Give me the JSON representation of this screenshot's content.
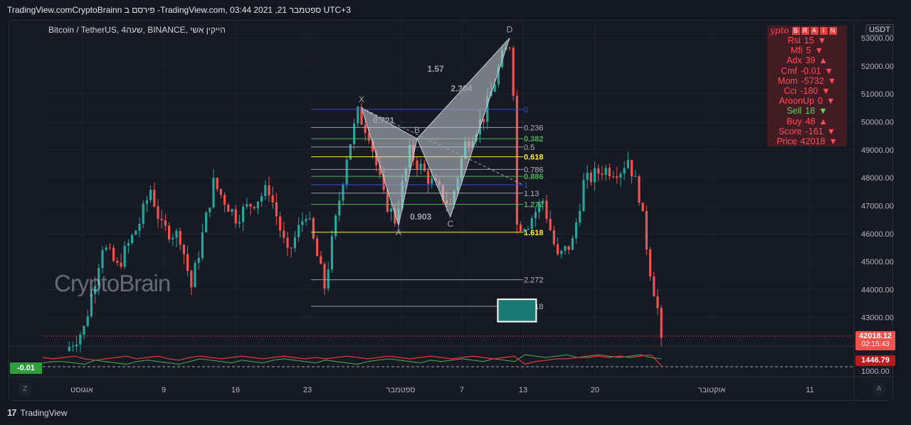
{
  "header": {
    "title": "TradingView.comCryptoBrainn פירסם ב -TradingView.com, 03:44 2021 ,21 ספטמבר UTC+3"
  },
  "symbol": {
    "label": "Bitcoin / TetherUS, 4שעה, BINANCE, הייקין אשי"
  },
  "currency_button": "USDT",
  "watermark": "CryptoBrain",
  "footer": {
    "brand": "TradingView"
  },
  "colors": {
    "up": "#26a69a",
    "down": "#ef5350",
    "grid": "#1f2330",
    "pattern": "#c8ccd4"
  },
  "panel": {
    "brand": "ypto",
    "tags": [
      "B",
      "R",
      "A",
      "I",
      "N"
    ],
    "rows": [
      {
        "name": "Rsi",
        "value": "15",
        "dir": "down"
      },
      {
        "name": "Mfi",
        "value": "5",
        "dir": "down"
      },
      {
        "name": "Adx",
        "value": "39",
        "dir": "up"
      },
      {
        "name": "Cmf",
        "value": "-0.01",
        "dir": "down"
      },
      {
        "name": "Mom",
        "value": "-5732",
        "dir": "down"
      },
      {
        "name": "Cci",
        "value": "-180",
        "dir": "down"
      },
      {
        "name": "AroonUp",
        "value": "0",
        "dir": "down"
      },
      {
        "name": "Sell",
        "value": "18",
        "dir": "down"
      },
      {
        "name": "Buy",
        "value": "48",
        "dir": "up"
      },
      {
        "name": "Score",
        "value": "-161",
        "dir": "down"
      },
      {
        "name": "Price",
        "value": "42018",
        "dir": "down"
      }
    ]
  },
  "price_tags": {
    "current": "42018.12",
    "countdown": "02:15:43",
    "indicator": "1446.79",
    "left_value": "-0.01"
  },
  "chart_data": {
    "type": "candlestick",
    "title": "",
    "ylim": [
      42000,
      53600
    ],
    "y_ticks": [
      43000,
      44000,
      45000,
      46000,
      47000,
      48000,
      49000,
      50000,
      51000,
      52000,
      53000
    ],
    "y_tick_labels": [
      "43000.00",
      "44000.00",
      "45000.00",
      "46000.00",
      "47000.00",
      "48000.00",
      "49000.00",
      "50000.00",
      "51000.00",
      "52000.00",
      "53000.00"
    ],
    "indicator_tick_label": "1000.00",
    "x_tick_labels": [
      "אוגוסט",
      "9",
      "16",
      "23",
      "ספטמבר",
      "7",
      "13",
      "20",
      "אוקטובר",
      "11"
    ],
    "anchors": [
      {
        "x": 0,
        "price": 41800
      },
      {
        "x": 5,
        "price": 42600
      },
      {
        "x": 10,
        "price": 45600
      },
      {
        "x": 14,
        "price": 44800
      },
      {
        "x": 20,
        "price": 46400
      },
      {
        "x": 23,
        "price": 47600
      },
      {
        "x": 26,
        "price": 46200
      },
      {
        "x": 31,
        "price": 45900
      },
      {
        "x": 34,
        "price": 44100
      },
      {
        "x": 40,
        "price": 47800
      },
      {
        "x": 46,
        "price": 46600
      },
      {
        "x": 55,
        "price": 47600
      },
      {
        "x": 60,
        "price": 45200
      },
      {
        "x": 65,
        "price": 46800
      },
      {
        "x": 70,
        "price": 44100
      },
      {
        "x": 76,
        "price": 48800
      },
      {
        "x": 79,
        "price": 50300
      },
      {
        "x": 82,
        "price": 49600
      },
      {
        "x": 86,
        "price": 47300
      },
      {
        "x": 89,
        "price": 46500
      },
      {
        "x": 93,
        "price": 48900
      },
      {
        "x": 98,
        "price": 48000
      },
      {
        "x": 104,
        "price": 47000
      },
      {
        "x": 108,
        "price": 49200
      },
      {
        "x": 113,
        "price": 50200
      },
      {
        "x": 118,
        "price": 52300
      },
      {
        "x": 120,
        "price": 52800
      },
      {
        "x": 121,
        "price": 51200
      },
      {
        "x": 122,
        "price": 46300
      },
      {
        "x": 125,
        "price": 46400
      },
      {
        "x": 129,
        "price": 47200
      },
      {
        "x": 133,
        "price": 45100
      },
      {
        "x": 137,
        "price": 45700
      },
      {
        "x": 140,
        "price": 47800
      },
      {
        "x": 145,
        "price": 48300
      },
      {
        "x": 150,
        "price": 48300
      },
      {
        "x": 152,
        "price": 48700
      },
      {
        "x": 155,
        "price": 47400
      },
      {
        "x": 158,
        "price": 44700
      },
      {
        "x": 160,
        "price": 43300
      },
      {
        "x": 161,
        "price": 42000
      }
    ],
    "harmonic_pattern": {
      "points": [
        {
          "label": "X",
          "x": 80,
          "price": 50500
        },
        {
          "label": "A",
          "x": 90,
          "price": 46300
        },
        {
          "label": "B",
          "x": 95,
          "price": 49400
        },
        {
          "label": "C",
          "x": 104,
          "price": 46600
        },
        {
          "label": "D",
          "x": 120,
          "price": 53000
        }
      ],
      "ratios": [
        {
          "text": "0.721",
          "x": 86,
          "price": 49950
        },
        {
          "text": "0.903",
          "x": 96,
          "price": 46500
        },
        {
          "text": "1.57",
          "x": 100,
          "price": 51800
        },
        {
          "text": "2.304",
          "x": 107,
          "price": 51100
        }
      ]
    },
    "fib_levels": [
      {
        "label": "0",
        "price": 50450,
        "color": "#3350d0"
      },
      {
        "label": "0.236",
        "price": 49800,
        "color": "#9e9e9e"
      },
      {
        "label": "0.382",
        "price": 49400,
        "color": "#4caf50"
      },
      {
        "label": "0.5",
        "price": 49100,
        "color": "#9e9e9e"
      },
      {
        "label": "0.618",
        "price": 48750,
        "color": "#ffeb3b"
      },
      {
        "label": "0.786",
        "price": 48300,
        "color": "#9e9e9e"
      },
      {
        "label": "0.886",
        "price": 48050,
        "color": "#4caf50"
      },
      {
        "label": "1",
        "price": 47750,
        "color": "#3350d0"
      },
      {
        "label": "1.13",
        "price": 47450,
        "color": "#9e9e9e"
      },
      {
        "label": "1.272",
        "price": 47050,
        "color": "#4caf50"
      },
      {
        "label": "1.618",
        "price": 46050,
        "color": "#ffeb3b"
      },
      {
        "label": "2.272",
        "price": 44350,
        "color": "#9e9e9e"
      },
      {
        "label": "2.618",
        "price": 43400,
        "color": "#9e9e9e"
      }
    ],
    "target_box": {
      "x_start": 117,
      "x_end": 127,
      "price_top": 43650,
      "price_bottom": 42850
    },
    "indicator": {
      "green": [
        6,
        7,
        7,
        6,
        5,
        8,
        7,
        6,
        5,
        7,
        8,
        7,
        6,
        5,
        7,
        9,
        8,
        7,
        6,
        8,
        7,
        6,
        8,
        9,
        8,
        7,
        6,
        8,
        7,
        6,
        5,
        7,
        8,
        9,
        8,
        7,
        6,
        8,
        7,
        8,
        9,
        8,
        7,
        9,
        8,
        7,
        12,
        11,
        10,
        11,
        12,
        10,
        11,
        12,
        11,
        10,
        11,
        12,
        10,
        9
      ],
      "red": [
        10,
        9,
        10,
        11,
        9,
        8,
        9,
        10,
        11,
        9,
        10,
        11,
        9,
        8,
        10,
        11,
        10,
        9,
        10,
        11,
        10,
        9,
        10,
        11,
        10,
        9,
        10,
        9,
        10,
        11,
        10,
        9,
        10,
        11,
        10,
        9,
        10,
        11,
        10,
        9,
        10,
        11,
        10,
        9,
        10,
        11,
        5,
        7,
        8,
        9,
        9,
        10,
        10,
        11,
        10,
        11,
        10,
        11,
        12,
        4
      ]
    }
  }
}
